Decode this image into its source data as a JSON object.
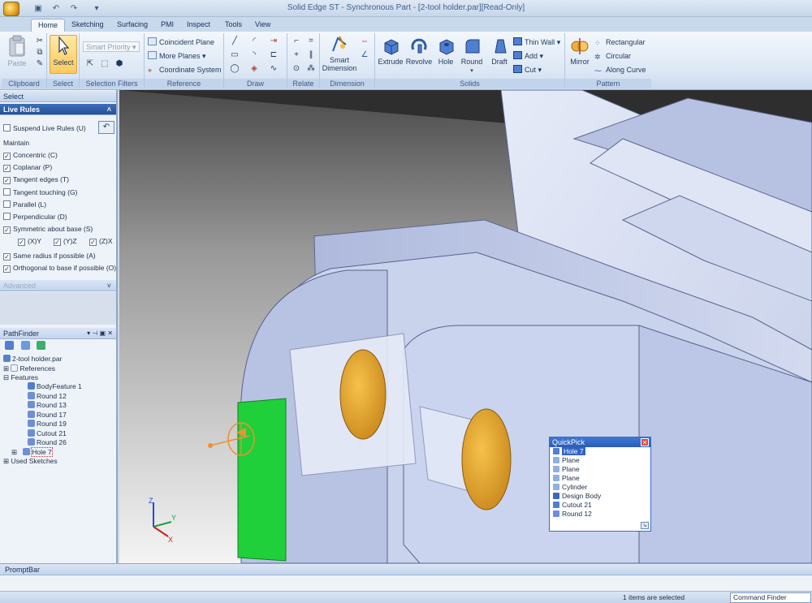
{
  "window": {
    "title": "Solid Edge ST - Synchronous Part - [2-tool holder.par][Read-Only]"
  },
  "tabs": [
    "Home",
    "Sketching",
    "Surfacing",
    "PMI",
    "Inspect",
    "Tools",
    "View"
  ],
  "ribbon": {
    "clipboard": {
      "label": "Clipboard",
      "paste": "Paste"
    },
    "select": {
      "label": "Select",
      "button": "Select"
    },
    "selection_filters": {
      "label": "Selection Filters",
      "smart_priority": "Smart Priority"
    },
    "reference": {
      "label": "Reference",
      "items": [
        "Coincident Plane",
        "More Planes",
        "Coordinate System"
      ]
    },
    "draw": {
      "label": "Draw"
    },
    "relate": {
      "label": "Relate"
    },
    "dimension": {
      "label": "Dimension",
      "smart_dimension_1": "Smart",
      "smart_dimension_2": "Dimension"
    },
    "solids": {
      "label": "Solids",
      "buttons": [
        "Extrude",
        "Revolve",
        "Hole",
        "Round",
        "Draft"
      ],
      "small": [
        "Thin Wall",
        "Add",
        "Cut"
      ]
    },
    "pattern": {
      "label": "Pattern",
      "mirror": "Mirror",
      "items": [
        "Rectangular",
        "Circular",
        "Along Curve"
      ]
    }
  },
  "select_panel": {
    "title": "Select",
    "live_rules": "Live Rules",
    "suspend": "Suspend Live Rules (U)",
    "maintain_label": "Maintain",
    "rules": [
      {
        "label": "Concentric (C)",
        "checked": true
      },
      {
        "label": "Coplanar (P)",
        "checked": true
      },
      {
        "label": "Tangent edges (T)",
        "checked": true
      },
      {
        "label": "Tangent touching (G)",
        "checked": false
      },
      {
        "label": "Parallel (L)",
        "checked": false
      },
      {
        "label": "Perpendicular (D)",
        "checked": false
      },
      {
        "label": "Symmetric about base (S)",
        "checked": true
      }
    ],
    "sym_axes": [
      "(X)Y",
      "(Y)Z",
      "(Z)X"
    ],
    "rules2": [
      {
        "label": "Same radius if possible (A)",
        "checked": true
      },
      {
        "label": "Orthogonal to base if possible (O)",
        "checked": true
      }
    ],
    "advanced": "Advanced"
  },
  "pathfinder": {
    "title": "PathFinder",
    "root": "2-tool holder.par",
    "references": "References",
    "features_label": "Features",
    "features": [
      "BodyFeature 1",
      "Round 12",
      "Round 13",
      "Round 17",
      "Round 19",
      "Cutout 21",
      "Round 26",
      "Hole 7"
    ],
    "used_sketches": "Used Sketches"
  },
  "quickpick": {
    "title": "QuickPick",
    "items": [
      "Hole 7",
      "Plane",
      "Plane",
      "Plane",
      "Cylinder",
      "Design Body",
      "Cutout 21",
      "Round 12"
    ]
  },
  "triad": {
    "z": "Z",
    "y": "Y",
    "x": "X"
  },
  "promptbar": {
    "title": "PromptBar"
  },
  "statusbar": {
    "status": "1 items are selected",
    "command_finder": "Command Finder"
  },
  "colors": {
    "ribbon_blue": "#c2d4ec",
    "model_body": "#c9d3ec",
    "face_highlight": "#1fd03a",
    "hole_gold": "#e7ad3a"
  }
}
